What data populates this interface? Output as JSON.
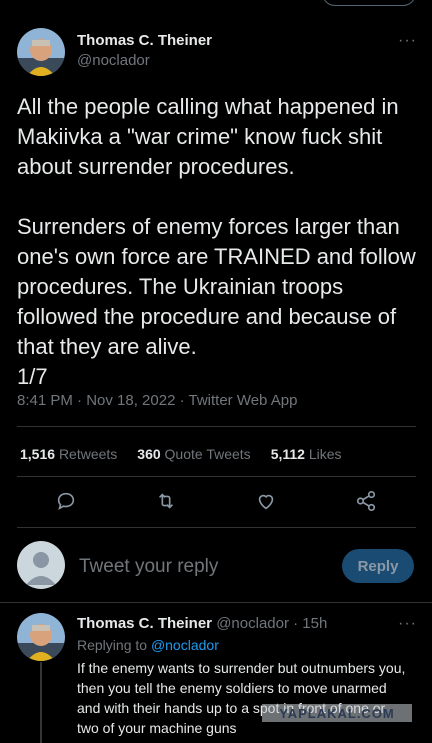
{
  "main_tweet": {
    "author_name": "Thomas C. Theiner",
    "author_handle": "@noclador",
    "more": "···",
    "text": "All the people calling what happened in Makiivka a \"war crime\" know fuck shit about surrender procedures.\n\nSurrenders of enemy forces larger than one's own force are TRAINED and follow procedures. The Ukrainian troops followed the procedure and because of that they are alive.\n1/7",
    "meta": "8:41 PM · Nov 18, 2022 · Twitter Web App",
    "stats": [
      {
        "count": "1,516",
        "label": "Retweets"
      },
      {
        "count": "360",
        "label": "Quote Tweets"
      },
      {
        "count": "5,112",
        "label": "Likes"
      }
    ],
    "actions": [
      "comment-icon",
      "retweet-icon",
      "like-icon",
      "share-icon"
    ]
  },
  "composer": {
    "placeholder": "Tweet your reply",
    "button": "Reply"
  },
  "reply_tweet": {
    "author_name": "Thomas C. Theiner",
    "handle_time": "@noclador · 15h",
    "more": "···",
    "replying_to_prefix": "Replying to ",
    "replying_to_handle": "@noclador",
    "text": "If the enemy wants to surrender but outnumbers you, then you tell the enemy soldiers to move unarmed and with their hands up to a spot in front of one or two of your machine guns"
  },
  "watermark": "YAPLAKAL.COM",
  "colors": {
    "background": "#000000",
    "text": "#e7e9ea",
    "muted": "#71767b",
    "accent": "#1d9bf0",
    "divider": "#2f3336"
  }
}
